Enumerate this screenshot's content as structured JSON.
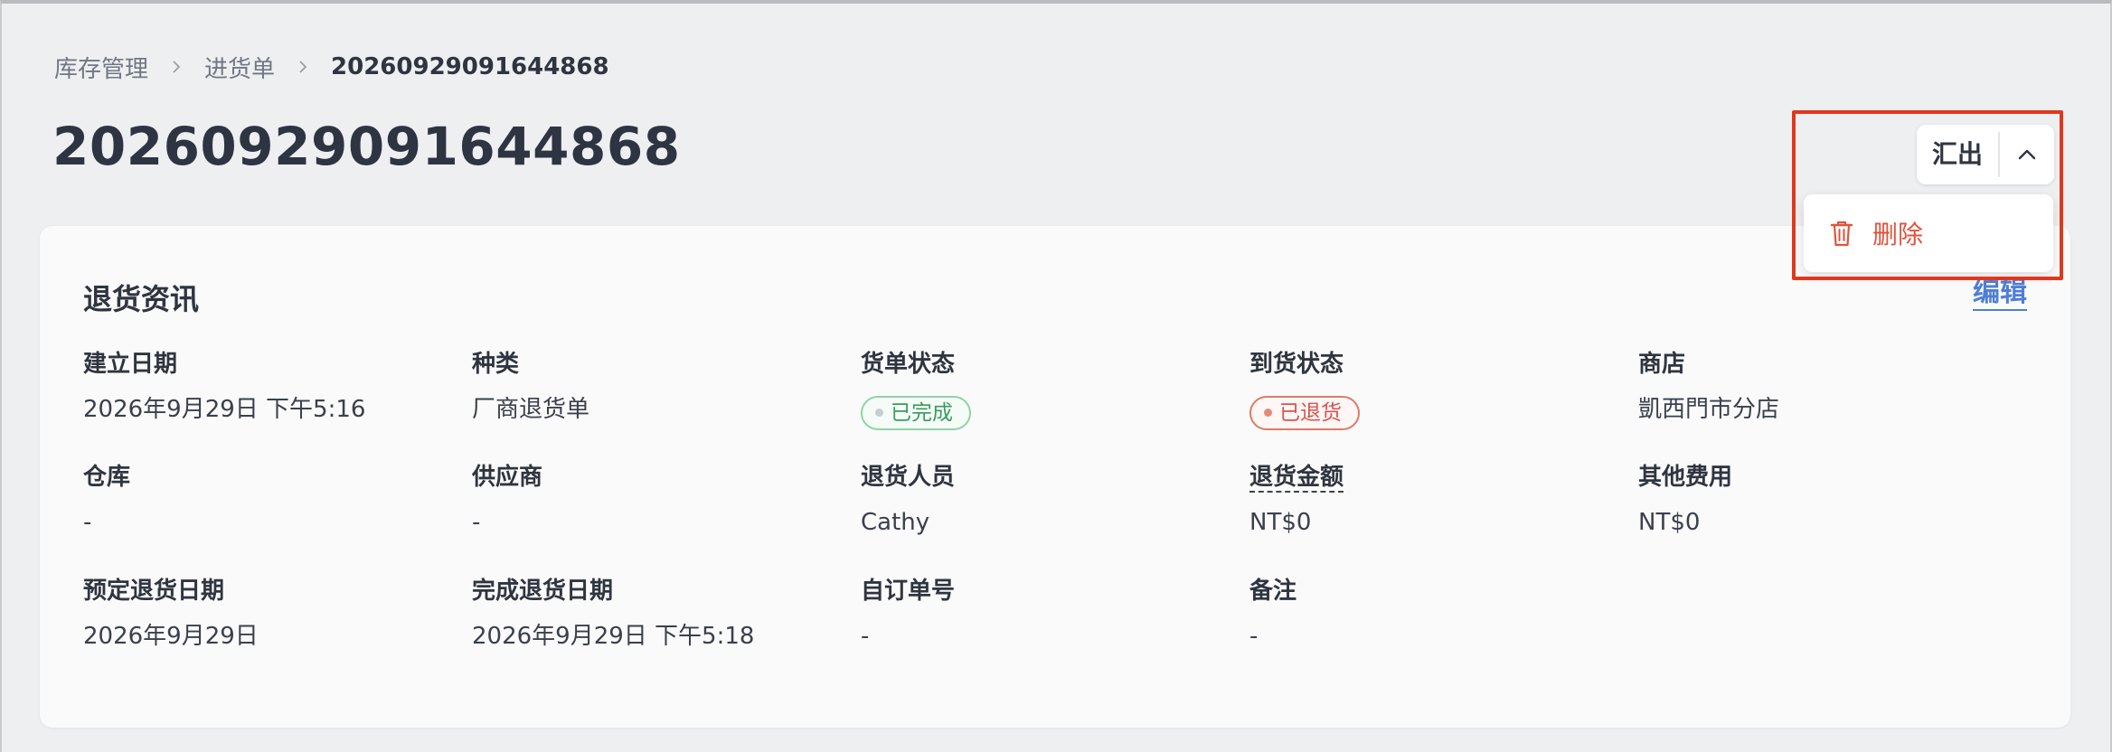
{
  "breadcrumb": {
    "items": [
      "库存管理",
      "进货单"
    ],
    "current": "20260929091644868"
  },
  "page": {
    "title": "20260929091644868"
  },
  "actions": {
    "export_label": "汇出",
    "menu": {
      "delete_label": "删除"
    }
  },
  "card": {
    "title": "退货资讯",
    "edit_label": "编辑",
    "fields": {
      "created_date": {
        "label": "建立日期",
        "value": "2026年9月29日 下午5:16"
      },
      "type": {
        "label": "种类",
        "value": "厂商退货单"
      },
      "order_status": {
        "label": "货单状态",
        "value": "已完成"
      },
      "arrival_status": {
        "label": "到货状态",
        "value": "已退货"
      },
      "store": {
        "label": "商店",
        "value": "凱西門市分店"
      },
      "warehouse": {
        "label": "仓库",
        "value": "-"
      },
      "supplier": {
        "label": "供应商",
        "value": "-"
      },
      "return_staff": {
        "label": "退货人员",
        "value": "Cathy"
      },
      "return_amount": {
        "label": "退货金额",
        "value": "NT$0"
      },
      "other_fees": {
        "label": "其他费用",
        "value": "NT$0"
      },
      "planned_return_date": {
        "label": "预定退货日期",
        "value": "2026年9月29日"
      },
      "completed_return_date": {
        "label": "完成退货日期",
        "value": "2026年9月29日 下午5:18"
      },
      "custom_order_no": {
        "label": "自订单号",
        "value": "-"
      },
      "notes": {
        "label": "备注",
        "value": "-"
      }
    }
  },
  "colors": {
    "status_completed": "#3b9a5f",
    "status_returned": "#d9534f",
    "delete": "#e0533d",
    "link": "#4f7ed6",
    "highlight": "#e1381c"
  },
  "icons": [
    "chevron-right-icon",
    "chevron-up-icon",
    "trash-icon",
    "status-dot-icon"
  ]
}
